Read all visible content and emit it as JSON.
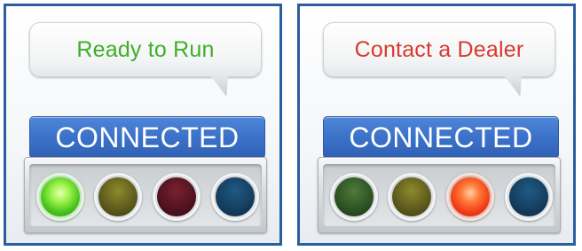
{
  "panels": [
    {
      "message": "Ready to Run",
      "message_color": "#3fae2a",
      "status": "CONNECTED",
      "lights": [
        {
          "color": "green",
          "state": "on"
        },
        {
          "color": "yellow",
          "state": "off"
        },
        {
          "color": "red",
          "state": "off"
        },
        {
          "color": "blue",
          "state": "off"
        }
      ]
    },
    {
      "message": "Contact a Dealer",
      "message_color": "#d83a2c",
      "status": "CONNECTED",
      "lights": [
        {
          "color": "green",
          "state": "off"
        },
        {
          "color": "yellow",
          "state": "off"
        },
        {
          "color": "red",
          "state": "on"
        },
        {
          "color": "blue",
          "state": "off"
        }
      ]
    }
  ],
  "colors": {
    "frame": "#2a5f9e",
    "status_bar": "#3b72c9"
  }
}
